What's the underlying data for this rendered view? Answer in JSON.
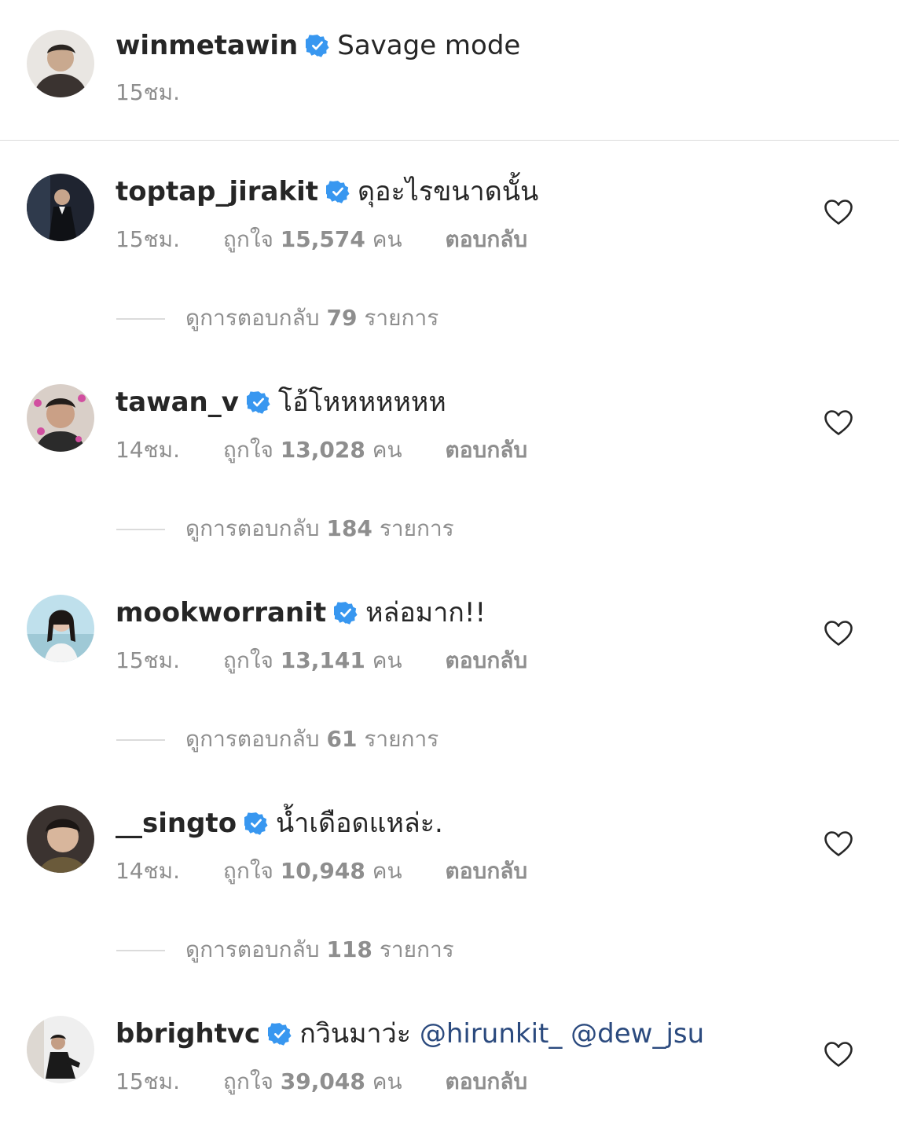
{
  "post": {
    "username": "winmetawin",
    "text": "Savage mode",
    "time": "15ชม."
  },
  "labels": {
    "likes_prefix": "ถูกใจ",
    "likes_suffix": "คน",
    "reply": "ตอบกลับ",
    "view_replies_prefix": "ดูการตอบกลับ",
    "view_replies_suffix": "รายการ"
  },
  "comments": [
    {
      "username": "toptap_jirakit",
      "text": "ดุอะไรขนาดนั้น",
      "time": "15ชม.",
      "likes": "15,574",
      "replies": "79"
    },
    {
      "username": "tawan_v",
      "text": "โอ้โหหหหหหห",
      "time": "14ชม.",
      "likes": "13,028",
      "replies": "184"
    },
    {
      "username": "mookworranit",
      "text": "หล่อมาก!!",
      "time": "15ชม.",
      "likes": "13,141",
      "replies": "61"
    },
    {
      "username": "__singto",
      "text": "น้ำเดือดแหล่ะ.",
      "time": "14ชม.",
      "likes": "10,948",
      "replies": "118"
    },
    {
      "username": "bbrightvc",
      "text": "กวินมาว่ะ",
      "mentions": [
        "@hirunkit_",
        "@dew_jsu"
      ],
      "time": "15ชม.",
      "likes": "39,048"
    }
  ],
  "colors": {
    "text": "#262626",
    "secondary": "#8e8e8e",
    "verified": "#3897f0",
    "mention": "#2b4a7e",
    "divider": "#dbdbdb"
  },
  "icons": {
    "verified": "verified-badge-icon",
    "like": "heart-outline-icon"
  }
}
